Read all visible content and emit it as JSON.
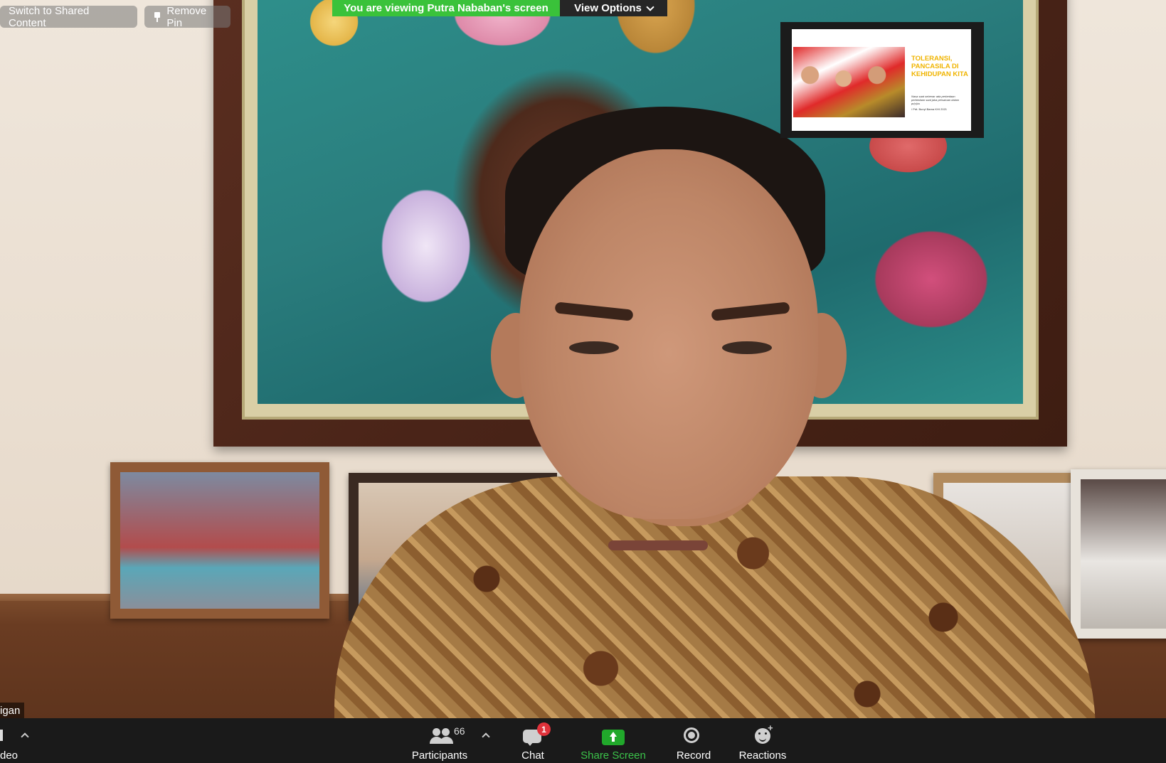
{
  "top_controls": {
    "switch_label": "Switch to Shared Content",
    "remove_pin_label": "Remove Pin"
  },
  "banner": {
    "viewing_text": "You are viewing Putra Nababan's screen",
    "view_options_label": "View Options",
    "accent_color": "#3ac23a"
  },
  "shared_slide": {
    "title": "TOLERANSI, PANCASILA DI KEHIDUPAN KITA",
    "subtitle": "Nasa saat sebenar ada perbedaan perbedaan saat jaka persatuan dalam pr(c)ta.",
    "author": "/ Pdt. Bunyl Barna KHI 2021",
    "title_color": "#f0b400"
  },
  "video": {
    "name_tag": "igan"
  },
  "toolbar": {
    "video_label": "deo",
    "participants_label": "Participants",
    "participants_count": "66",
    "chat_label": "Chat",
    "chat_badge": "1",
    "share_label": "Share Screen",
    "record_label": "Record",
    "reactions_label": "Reactions",
    "share_color": "#3bc24a",
    "badge_color": "#e0323b"
  }
}
